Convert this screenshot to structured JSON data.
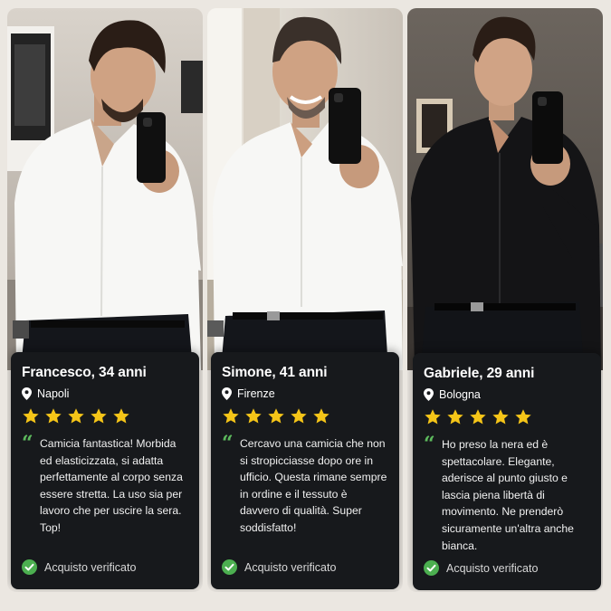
{
  "reviews": [
    {
      "name": "Francesco, 34 anni",
      "location": "Napoli",
      "rating": 5,
      "quote_icon": "quote-icon",
      "text": "Camicia fantastica! Morbida ed elasticizzata, si adatta perfettamente al corpo senza essere stretta. La uso sia per lavoro che per uscire la sera. Top!",
      "verified": "Acquisto verificato",
      "shirt_color": "#f7f7f5"
    },
    {
      "name": "Simone, 41 anni",
      "location": "Firenze",
      "rating": 5,
      "quote_icon": "quote-icon",
      "text": "Cercavo una camicia che non si stropicciasse dopo ore in ufficio. Questa rimane sempre in ordine e il tessuto è davvero di qualità. Super soddisfatto!",
      "verified": "Acquisto verificato",
      "shirt_color": "#f7f7f5"
    },
    {
      "name": "Gabriele, 29 anni",
      "location": "Bologna",
      "rating": 5,
      "quote_icon": "quote-icon",
      "text": "Ho preso la nera ed è spettacolare. Elegante, aderisce al punto giusto e lascia piena libertà di movimento. Ne prenderò sicuramente un'altra anche bianca.",
      "verified": "Acquisto verificato",
      "shirt_color": "#141416"
    }
  ],
  "colors": {
    "star": "#f5c518",
    "accent_green": "#4caf50",
    "card_bg": "#17191c",
    "page_bg": "#ebe7e1"
  }
}
